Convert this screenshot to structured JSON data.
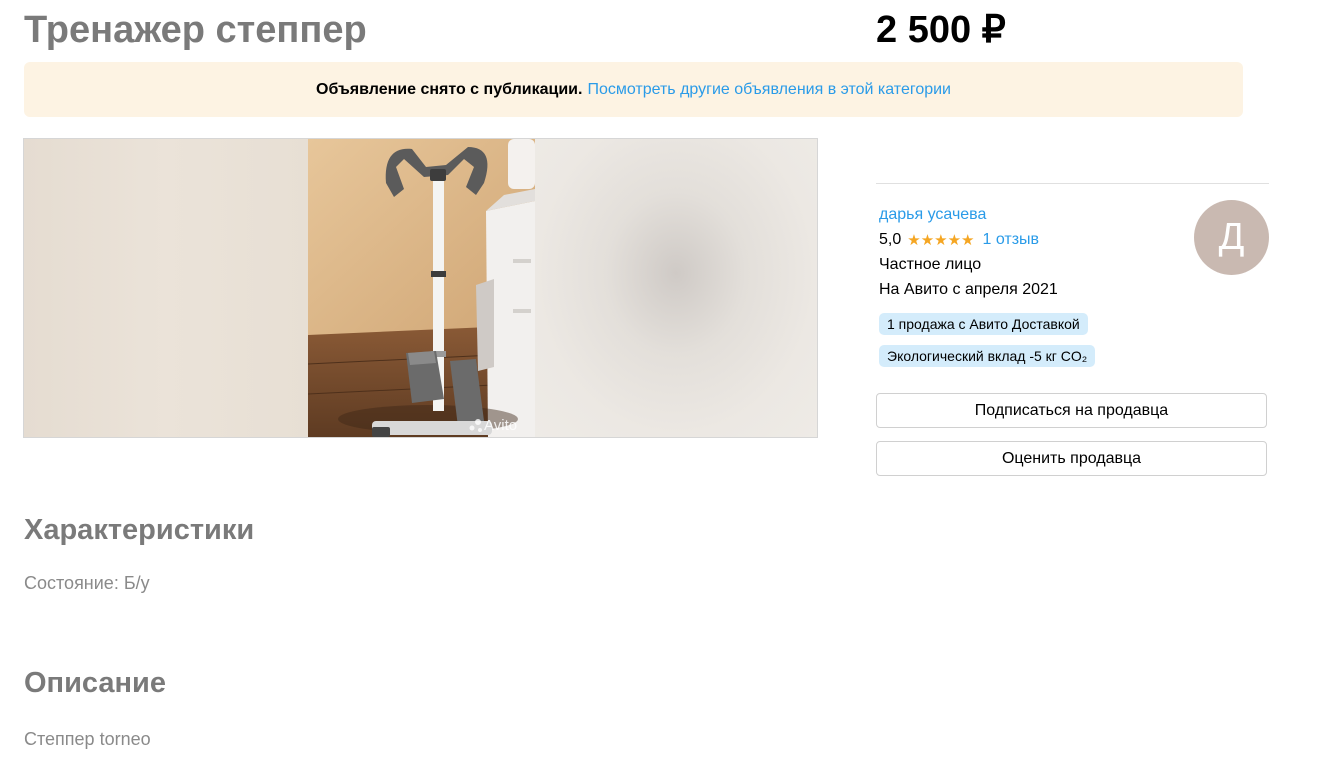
{
  "listing": {
    "title": "Тренажер степпер",
    "price": "2 500 ₽"
  },
  "notice": {
    "message": "Объявление снято с публикации.",
    "link": "Посмотреть другие объявления в этой категории"
  },
  "gallery": {
    "watermark": "Avito"
  },
  "seller": {
    "name": "дарья усачева",
    "rating": "5,0",
    "stars": "★★★★★",
    "reviews": "1 отзыв",
    "type": "Частное лицо",
    "since": "На Авито с апреля 2021",
    "badges": [
      "1 продажа с Авито Доставкой",
      "Экологический вклад -5 кг CO₂"
    ],
    "avatar_letter": "Д",
    "subscribe_label": "Подписаться на продавца",
    "rate_label": "Оценить продавца"
  },
  "specs": {
    "heading": "Характеристики",
    "condition": "Состояние: Б/у"
  },
  "description": {
    "heading": "Описание",
    "text": "Степпер torneo"
  },
  "colors": {
    "link": "#2a9be8",
    "notice_bg": "#fdf3e3",
    "badge_bg": "#d4ecfb",
    "star": "#f5a623",
    "avatar_bg": "#c9b9b1"
  }
}
